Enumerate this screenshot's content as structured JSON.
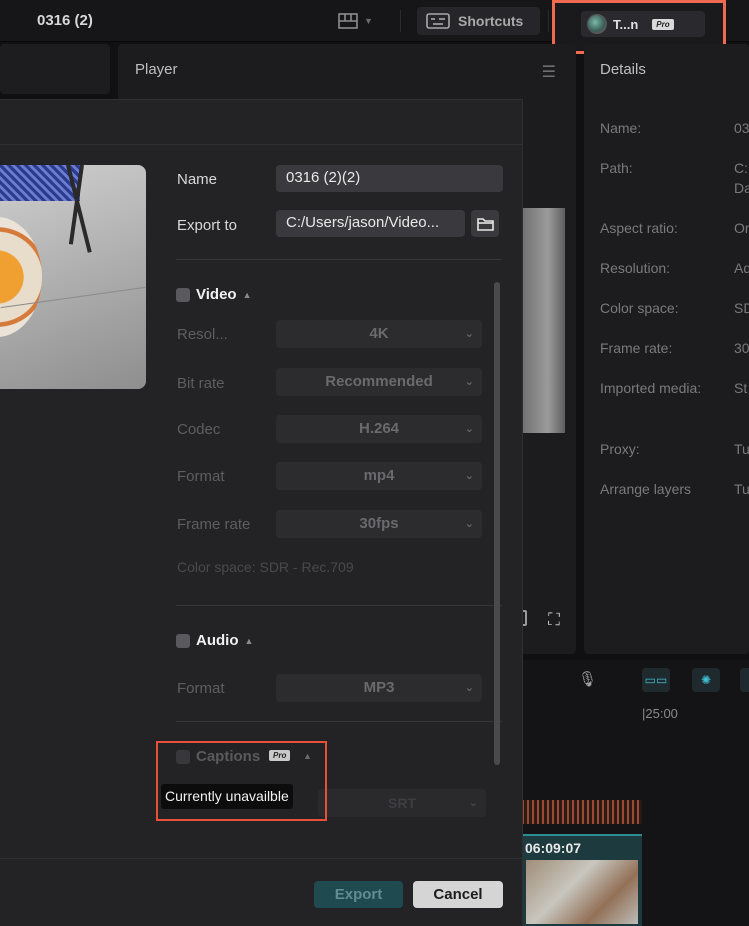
{
  "topbar": {
    "project_title": "0316 (2)",
    "shortcuts_label": "Shortcuts",
    "user_name": "T...n",
    "pro_badge": "Pro"
  },
  "player": {
    "title": "Player"
  },
  "details": {
    "title": "Details",
    "rows": [
      {
        "label": "Name:",
        "value": "03"
      },
      {
        "label": "Path:",
        "value": "C:"
      },
      {
        "label": "",
        "value": "Da"
      },
      {
        "label": "Aspect ratio:",
        "value": "Or"
      },
      {
        "label": "Resolution:",
        "value": "Ad"
      },
      {
        "label": "Color space:",
        "value": "SD"
      },
      {
        "label": "Frame rate:",
        "value": "30"
      },
      {
        "label": "Imported media:",
        "value": "St"
      },
      {
        "label": "Proxy:",
        "value": "Tu"
      },
      {
        "label": "Arrange layers",
        "value": "Tu"
      }
    ]
  },
  "timeline": {
    "time_marker": "|25:00",
    "clip_time": "06:09:07"
  },
  "export_dialog": {
    "name_label": "Name",
    "name_value": "0316 (2)(2)",
    "export_to_label": "Export to",
    "export_to_value": "C:/Users/jason/Video...",
    "video": {
      "title": "Video",
      "resolution_label": "Resol...",
      "resolution_value": "4K",
      "bitrate_label": "Bit rate",
      "bitrate_value": "Recommended",
      "codec_label": "Codec",
      "codec_value": "H.264",
      "format_label": "Format",
      "format_value": "mp4",
      "framerate_label": "Frame rate",
      "framerate_value": "30fps",
      "color_space_note": "Color space: SDR - Rec.709"
    },
    "audio": {
      "title": "Audio",
      "format_label": "Format",
      "format_value": "MP3"
    },
    "captions": {
      "title": "Captions",
      "pro_badge": "Pro",
      "tooltip": "Currently unavailble",
      "format_value": "SRT"
    },
    "export_label": "Export",
    "cancel_label": "Cancel"
  },
  "colors": {
    "accent_teal": "#1e4a50",
    "highlight_red": "#e8503a"
  }
}
